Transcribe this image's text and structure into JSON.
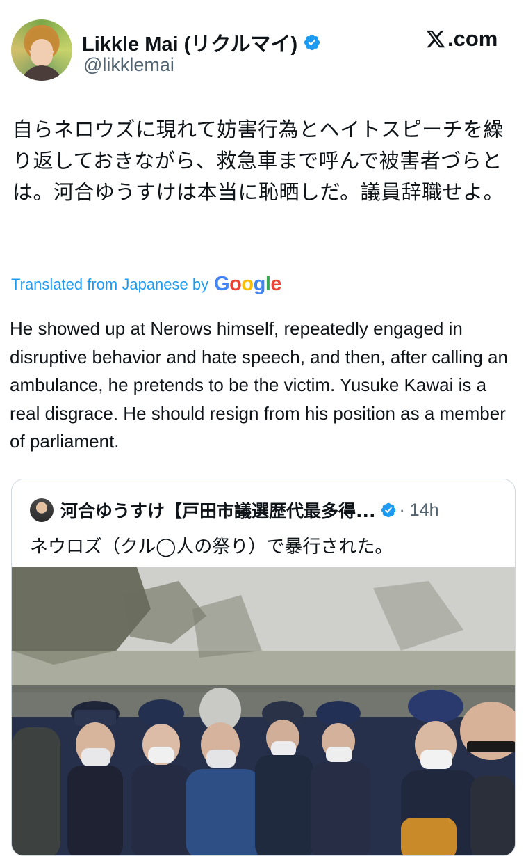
{
  "author": {
    "display_name": "Likkle Mai (リクルマイ)",
    "handle": "@likklemai",
    "verified": true
  },
  "brand": {
    "label": ".com"
  },
  "tweet": {
    "text_ja": "自らネロウズに現れて妨害行為とヘイトスピーチを繰り返しておきながら、救急車まで呼んで被害者づらとは。河合ゆうすけは本当に恥晒しだ。議員辞職せよ。",
    "translated_label": "Translated from Japanese by",
    "translation_provider": "Google",
    "text_en": "He showed up at Nerows himself, repeatedly engaged in disruptive behavior and hate speech, and then, after calling an ambulance, he pretends to be the victim. Yusuke Kawai is a real disgrace. He should resign from his position as a member of parliament."
  },
  "quoted_tweet": {
    "author_name": "河合ゆうすけ【戸田市議選歴代最多得...",
    "verified": true,
    "time": "· 14h",
    "text": "ネウロズ（クル◯人の祭り）で暴行された。",
    "media": "crowd-photo"
  },
  "colors": {
    "link": "#1d9bf0",
    "verified": "#1d9bf0",
    "secondary_text": "#536471",
    "border": "#cfd9de"
  }
}
